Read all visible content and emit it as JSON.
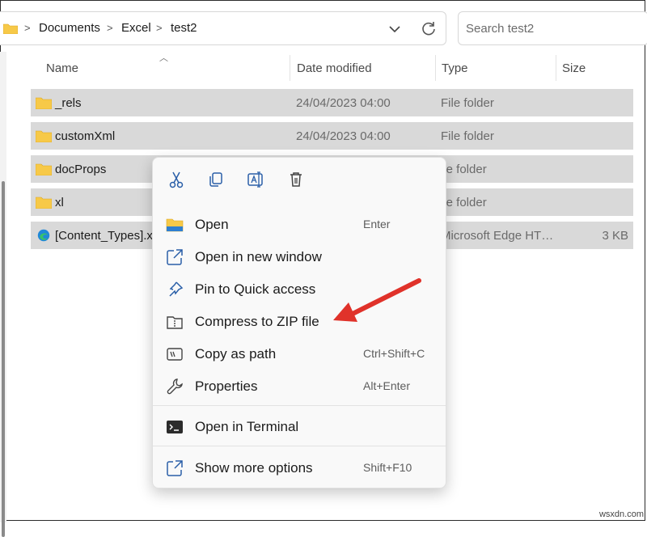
{
  "address_bar": {
    "breadcrumbs": [
      "Documents",
      "Excel",
      "test2"
    ],
    "separator": ">",
    "folder_icon": "folder-icon",
    "dropdown_icon": "chevron-down-icon",
    "refresh_icon": "refresh-icon"
  },
  "search": {
    "placeholder": "Search test2"
  },
  "columns": {
    "name": "Name",
    "date": "Date modified",
    "type": "Type",
    "size": "Size"
  },
  "files": [
    {
      "name": "_rels",
      "date": "24/04/2023 04:00",
      "type": "File folder",
      "size": "",
      "icon": "folder-icon"
    },
    {
      "name": "customXml",
      "date": "24/04/2023 04:00",
      "type": "File folder",
      "size": "",
      "icon": "folder-icon"
    },
    {
      "name": "docProps",
      "date": "",
      "type": "ile folder",
      "size": "",
      "icon": "folder-icon"
    },
    {
      "name": "xl",
      "date": "",
      "type": "ile folder",
      "size": "",
      "icon": "folder-icon"
    },
    {
      "name": "[Content_Types].xr",
      "date": "",
      "type": "Microsoft Edge HT…",
      "size": "3 KB",
      "icon": "edge-icon"
    }
  ],
  "context_menu": {
    "toolbar": [
      "cut-icon",
      "copy-icon",
      "rename-icon",
      "delete-icon"
    ],
    "items": [
      {
        "label": "Open",
        "shortcut": "Enter",
        "icon": "folder-open-icon"
      },
      {
        "label": "Open in new window",
        "shortcut": "",
        "icon": "new-window-icon"
      },
      {
        "label": "Pin to Quick access",
        "shortcut": "",
        "icon": "pin-icon"
      },
      {
        "label": "Compress to ZIP file",
        "shortcut": "",
        "icon": "zip-icon"
      },
      {
        "label": "Copy as path",
        "shortcut": "Ctrl+Shift+C",
        "icon": "copy-path-icon"
      },
      {
        "label": "Properties",
        "shortcut": "Alt+Enter",
        "icon": "wrench-icon"
      },
      {
        "label": "Open in Terminal",
        "shortcut": "",
        "icon": "terminal-icon"
      },
      {
        "label": "Show more options",
        "shortcut": "Shift+F10",
        "icon": "more-options-icon"
      }
    ]
  },
  "watermark": "wsxdn.com",
  "colors": {
    "selection": "#d9d9d9",
    "folder": "#f7c948",
    "arrow": "#e0322a"
  }
}
